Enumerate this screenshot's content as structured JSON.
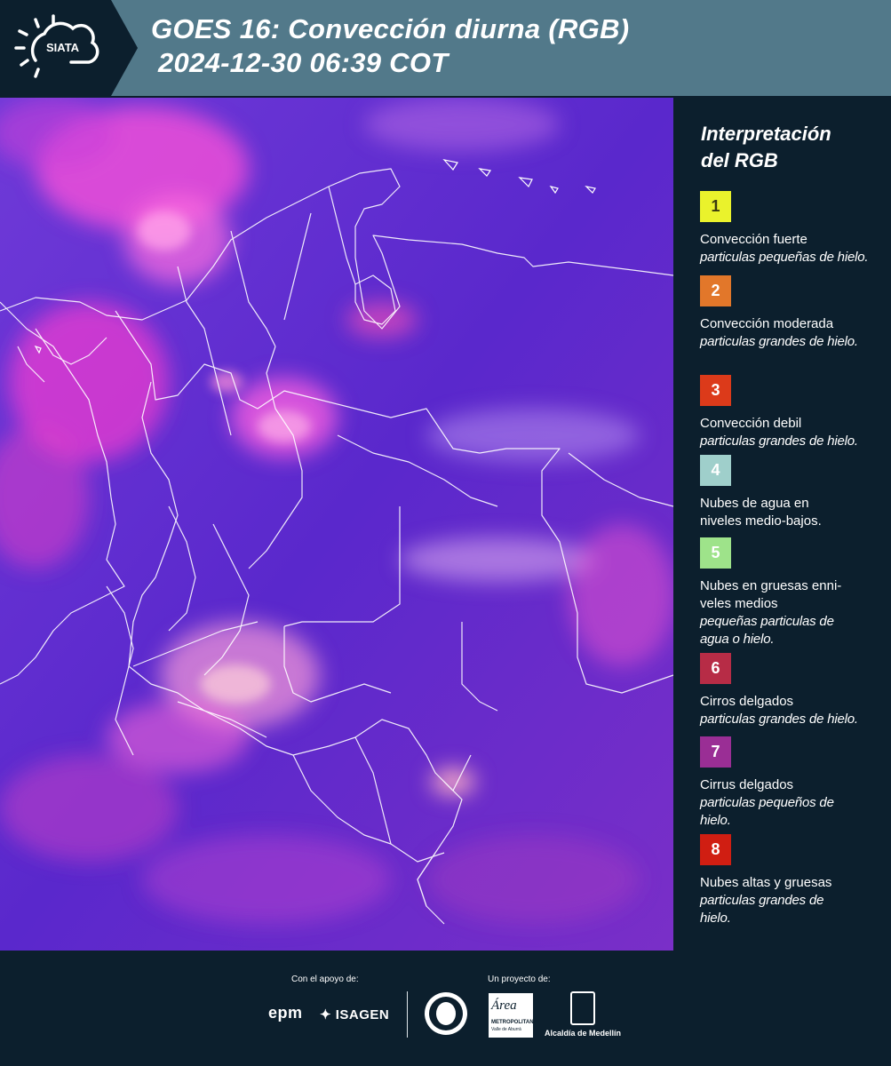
{
  "header": {
    "logo_text": "SIATA",
    "title_line1": "GOES 16: Convección diurna (RGB)",
    "title_line2": "2024-12-30 06:39 COT",
    "background_color": "#52798a"
  },
  "legend": {
    "title_line1": "Interpretación",
    "title_line2": "del RGB",
    "items": [
      {
        "number": "1",
        "color": "#eaf22c",
        "number_color": "#3a3a10",
        "label": "Convección fuerte",
        "sub": "particulas pequeñas de hielo."
      },
      {
        "number": "2",
        "color": "#e2772a",
        "number_color": "#ffffff",
        "label": "Convección moderada",
        "sub": "particulas grandes de hielo."
      },
      {
        "number": "3",
        "color": "#dc3a1a",
        "number_color": "#ffffff",
        "label": "Convección debil",
        "sub": "particulas grandes de hielo."
      },
      {
        "number": "4",
        "color": "#9fcfcb",
        "number_color": "#ffffff",
        "label": "Nubes de agua en niveles medio-bajos.",
        "sub": ""
      },
      {
        "number": "5",
        "color": "#9ee38a",
        "number_color": "#ffffff",
        "label": "Nubes en gruesas enni-veles medios",
        "sub": "pequeñas particulas de agua o hielo."
      },
      {
        "number": "6",
        "color": "#b72c46",
        "number_color": "#ffffff",
        "label": "Cirros delgados",
        "sub": "particulas grandes de hielo."
      },
      {
        "number": "7",
        "color": "#9a2e95",
        "number_color": "#ffffff",
        "label": "Cirrus delgados",
        "sub": "particulas pequeños de hielo."
      },
      {
        "number": "8",
        "color": "#d01e12",
        "number_color": "#ffffff",
        "label": "Nubes altas y gruesas",
        "sub": "particulas grandes de hielo."
      }
    ]
  },
  "footer": {
    "support_label": "Con el apoyo de:",
    "project_label": "Un proyecto de:",
    "sponsor1": "epm",
    "sponsor2": "ISAGEN",
    "area_logo_text": "Área",
    "area_logo_sub": "METROPOLITANA",
    "area_logo_sub2": "Valle de Aburrá",
    "alcaldia": "Alcaldía de Medellín"
  },
  "colors": {
    "map_base": "#6a2ad0",
    "map_magenta": "#ff3fd0",
    "map_pink": "#f79ad8",
    "border_lines": "#ffffff",
    "panel_background": "#0c1f2d"
  }
}
